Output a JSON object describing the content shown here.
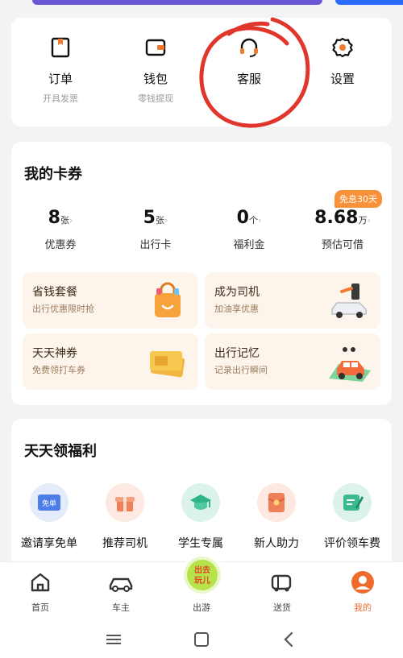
{
  "colors": {
    "accent": "#f06a2c",
    "badge": "#f7923a",
    "annotation": "#e0362b"
  },
  "quick_actions": [
    {
      "label": "订单",
      "sub": "开具发票",
      "icon": "order-icon"
    },
    {
      "label": "钱包",
      "sub": "零钱提现",
      "icon": "wallet-icon"
    },
    {
      "label": "客服",
      "sub": "",
      "icon": "headset-icon"
    },
    {
      "label": "设置",
      "sub": "",
      "icon": "gear-icon"
    }
  ],
  "coupons": {
    "title": "我的卡券",
    "badge": "免息30天",
    "stats": [
      {
        "num": "8",
        "unit": "张",
        "name": "优惠券"
      },
      {
        "num": "5",
        "unit": "张",
        "name": "出行卡"
      },
      {
        "num": "0",
        "unit": "个",
        "name": "福利金"
      },
      {
        "num": "8.68",
        "unit": "万",
        "name": "预估可借"
      }
    ],
    "promos": [
      {
        "title": "省钱套餐",
        "desc": "出行优惠限时抢",
        "icon": "shopping-bag-icon"
      },
      {
        "title": "成为司机",
        "desc": "加油享优惠",
        "icon": "fuel-car-icon"
      },
      {
        "title": "天天神券",
        "desc": "免费领打车券",
        "icon": "ticket-icon"
      },
      {
        "title": "出行记忆",
        "desc": "记录出行瞬间",
        "icon": "memory-car-icon"
      }
    ]
  },
  "welfare": {
    "title": "天天领福利",
    "items": [
      {
        "label": "邀请享免单",
        "icon": "free-ticket-icon",
        "icon_text": "免单"
      },
      {
        "label": "推荐司机",
        "icon": "gift-icon"
      },
      {
        "label": "学生专属",
        "icon": "graduation-cap-icon"
      },
      {
        "label": "新人助力",
        "icon": "red-envelope-icon"
      },
      {
        "label": "评价领车费",
        "icon": "review-icon"
      }
    ]
  },
  "tabbar": {
    "center_badge_text": "出去玩儿",
    "tabs": [
      {
        "label": "首页",
        "icon": "home-icon"
      },
      {
        "label": "车主",
        "icon": "car-icon"
      },
      {
        "label": "出游",
        "icon": "travel-icon"
      },
      {
        "label": "送货",
        "icon": "truck-icon"
      },
      {
        "label": "我的",
        "icon": "profile-icon"
      }
    ]
  },
  "system_nav": [
    "menu-icon",
    "home-square-icon",
    "back-icon"
  ]
}
